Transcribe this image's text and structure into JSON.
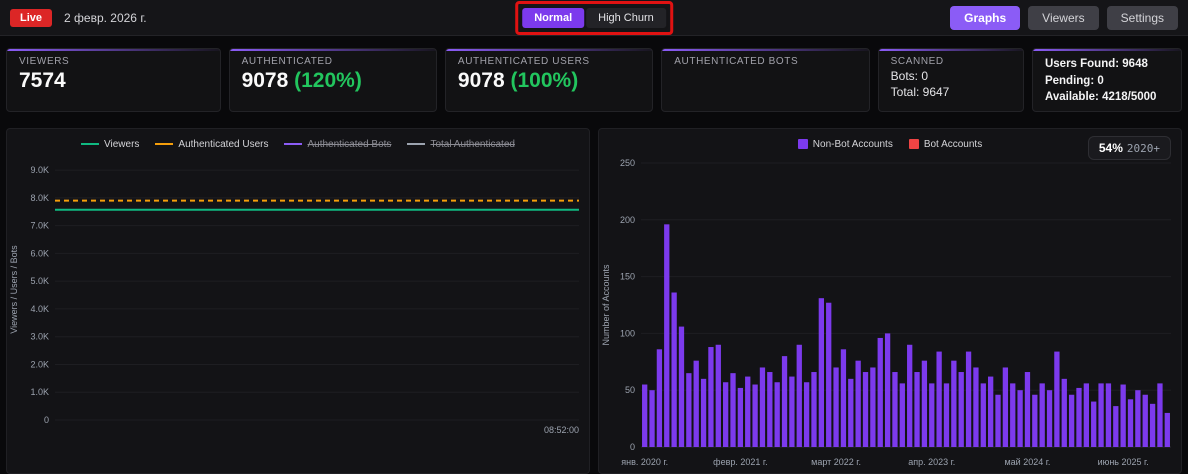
{
  "topbar": {
    "live_label": "Live",
    "date": "2 февр. 2026 г.",
    "toggle": {
      "normal": "Normal",
      "high_churn": "High Churn"
    },
    "buttons": {
      "graphs": "Graphs",
      "viewers": "Viewers",
      "settings": "Settings"
    }
  },
  "cards": {
    "viewers": {
      "label": "VIEWERS",
      "value": "7574"
    },
    "authenticated": {
      "label": "AUTHENTICATED",
      "value": "9078",
      "percent": "(120%)"
    },
    "authenticated_users": {
      "label": "AUTHENTICATED USERS",
      "value": "9078",
      "percent": "(100%)"
    },
    "authenticated_bots": {
      "label": "AUTHENTICATED BOTS"
    },
    "scanned": {
      "label": "SCANNED",
      "bots_line": "Bots: 0",
      "total_line": "Total: 9647"
    },
    "summary": {
      "users_found": "Users Found: 9648",
      "pending": "Pending: 0",
      "available": "Available: 4218/5000"
    }
  },
  "colors": {
    "accent_purple": "#7c3aed",
    "green": "#22c55e",
    "red": "#dc2626"
  },
  "chart_data": [
    {
      "type": "line",
      "title": "",
      "ylabel": "Viewers / Users / Bots",
      "ylim": [
        0,
        9400
      ],
      "yticks": [
        {
          "v": 9000,
          "label": "9.0K"
        },
        {
          "v": 8000,
          "label": "8.0K"
        },
        {
          "v": 7000,
          "label": "7.0K"
        },
        {
          "v": 6000,
          "label": "6.0K"
        },
        {
          "v": 5000,
          "label": "5.0K"
        },
        {
          "v": 4000,
          "label": "4.0K"
        },
        {
          "v": 3000,
          "label": "3.0K"
        },
        {
          "v": 2000,
          "label": "2.0K"
        },
        {
          "v": 1000,
          "label": "1.0K"
        },
        {
          "v": 0,
          "label": "0"
        }
      ],
      "x_end_label": "08:52:00",
      "legend": [
        {
          "label": "Viewers",
          "color": "#10b981",
          "disabled": false
        },
        {
          "label": "Authenticated Users",
          "color": "#f59e0b",
          "disabled": false
        },
        {
          "label": "Authenticated Bots",
          "color": "#8b5cf6",
          "disabled": true
        },
        {
          "label": "Total Authenticated",
          "color": "#9ca3af",
          "disabled": true
        }
      ],
      "series": [
        {
          "name": "Viewers",
          "color": "#10b981",
          "dash": false,
          "value": 7574
        },
        {
          "name": "Authenticated Users",
          "color": "#f59e0b",
          "dash": true,
          "value": 7900
        }
      ]
    },
    {
      "type": "bar",
      "title": "",
      "ylabel": "Number of Accounts",
      "ylim": [
        0,
        250
      ],
      "yticks": [
        0,
        50,
        100,
        150,
        200,
        250
      ],
      "badge": {
        "percent": "54%",
        "suffix": "2020+"
      },
      "legend": [
        {
          "label": "Non-Bot Accounts",
          "color": "#7c3aed"
        },
        {
          "label": "Bot Accounts",
          "color": "#ef4444"
        }
      ],
      "xticks": [
        "янв. 2020 г.",
        "февр. 2021 г.",
        "март 2022 г.",
        "апр. 2023 г.",
        "май 2024 г.",
        "июнь 2025 г."
      ],
      "xtick_indices": [
        0,
        13,
        26,
        39,
        52,
        65
      ],
      "series": [
        {
          "name": "Non-Bot Accounts",
          "color": "#7c3aed",
          "values": [
            55,
            50,
            86,
            196,
            136,
            106,
            65,
            76,
            60,
            88,
            90,
            57,
            65,
            52,
            62,
            55,
            70,
            66,
            57,
            80,
            62,
            90,
            57,
            66,
            131,
            127,
            70,
            86,
            60,
            76,
            66,
            70,
            96,
            100,
            66,
            56,
            90,
            66,
            76,
            56,
            84,
            56,
            76,
            66,
            84,
            70,
            56,
            62,
            46,
            70,
            56,
            50,
            66,
            46,
            56,
            50,
            84,
            60,
            46,
            52,
            56,
            40,
            56,
            56,
            36,
            55,
            42,
            50,
            46,
            38,
            56,
            30
          ]
        },
        {
          "name": "Bot Accounts",
          "color": "#ef4444",
          "values": []
        }
      ]
    }
  ]
}
